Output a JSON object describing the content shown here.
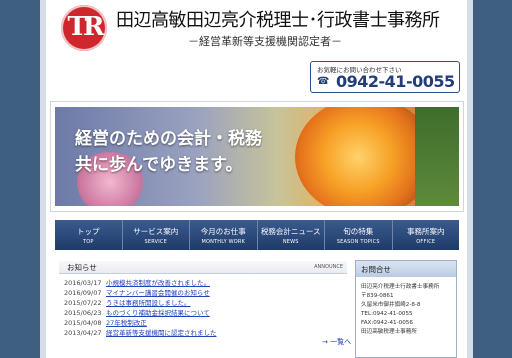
{
  "header": {
    "logo_text": "TR",
    "office_name": "田辺高敏田辺亮介税理士･行政書士事務所",
    "office_sub": "－経営革新等支援機関認定者－"
  },
  "contact": {
    "note": "お気軽にお問い合わせ下さい",
    "phone_icon": "☎",
    "phone": "0942-41-0055"
  },
  "hero": {
    "line1": "経営のための会計・税務",
    "line2": "共に歩んでゆきます。"
  },
  "nav": [
    {
      "jp": "トップ",
      "en": "TOP"
    },
    {
      "jp": "サービス案内",
      "en": "SERVICE"
    },
    {
      "jp": "今月のお仕事",
      "en": "MONTHLY WORK"
    },
    {
      "jp": "税務会計ニュース",
      "en": "NEWS"
    },
    {
      "jp": "旬の特集",
      "en": "SEASON TOPICS"
    },
    {
      "jp": "事務所案内",
      "en": "OFFICE"
    }
  ],
  "news": {
    "title": "お知らせ",
    "title_en": "ANNOUNCE",
    "items": [
      {
        "date": "2016/03/17",
        "text": "小規模共済制度が改善されました。"
      },
      {
        "date": "2016/09/07",
        "text": "マイナンバー講習会開催のお知らせ"
      },
      {
        "date": "2015/07/22",
        "text": "うきは事務所開設しました。"
      },
      {
        "date": "2015/06/23",
        "text": "ものづくり補助金採択結果について"
      },
      {
        "date": "2015/04/08",
        "text": "27年税制改正"
      },
      {
        "date": "2013/04/27",
        "text": "経営革新等支援機関に認定されました"
      }
    ],
    "more": "→ 一覧へ"
  },
  "sidebar": {
    "title": "お問合せ",
    "lines": [
      "田辺亮介税理士行政書士事務所",
      "〒839-0861",
      "久留米市御井旗崎2-8-8",
      "",
      "TEL:0942-41-0055",
      "FAX:0942-41-0056",
      "",
      "田辺高敏税理士事務所"
    ]
  }
}
